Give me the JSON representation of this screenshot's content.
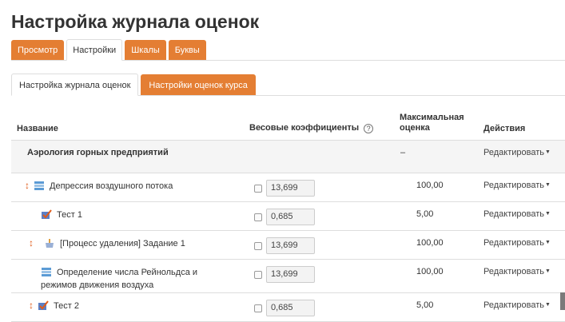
{
  "page": {
    "title": "Настройка журнала оценок"
  },
  "tabs": [
    {
      "label": "Просмотр",
      "state": "normal"
    },
    {
      "label": "Настройки",
      "state": "active"
    },
    {
      "label": "Шкалы",
      "state": "normal"
    },
    {
      "label": "Буквы",
      "state": "normal"
    }
  ],
  "subtabs": [
    {
      "label": "Настройка журнала оценок",
      "state": "active"
    },
    {
      "label": "Настройки оценок курса",
      "state": "normal"
    }
  ],
  "table": {
    "headers": {
      "name": "Название",
      "weights": "Весовые коэффициенты",
      "max_line1": "Максимальная",
      "max_line2": "оценка",
      "actions": "Действия"
    },
    "category": {
      "name": "Аэрология горных предприятий",
      "max": "–",
      "action": "Редактировать"
    },
    "rows": [
      {
        "name": "Депрессия воздушного потока",
        "icon": "grade-category-icon",
        "movable": true,
        "weight": "13,699",
        "max": "100,00",
        "action": "Редактировать"
      },
      {
        "name": "Тест 1",
        "icon": "quiz-icon",
        "movable": false,
        "weight": "0,685",
        "max": "5,00",
        "action": "Редактировать"
      },
      {
        "name": "[Процесс удаления] Задание 1",
        "icon": "assignment-icon",
        "movable": true,
        "weight": "13,699",
        "max": "100,00",
        "action": "Редактировать"
      },
      {
        "name_line1": "Определение числа Рейнольдса и",
        "name_line2": "режимов движения воздуха",
        "icon": "grade-category-icon",
        "movable": false,
        "weight": "13,699",
        "max": "100,00",
        "action": "Редактировать"
      },
      {
        "name": "Тест 2",
        "icon": "quiz-icon",
        "movable": true,
        "weight": "0,685",
        "max": "5,00",
        "action": "Редактировать"
      }
    ]
  },
  "colors": {
    "accent": "#e47e33",
    "move": "#e05c1a",
    "category_bg": "#f5f5f5"
  }
}
